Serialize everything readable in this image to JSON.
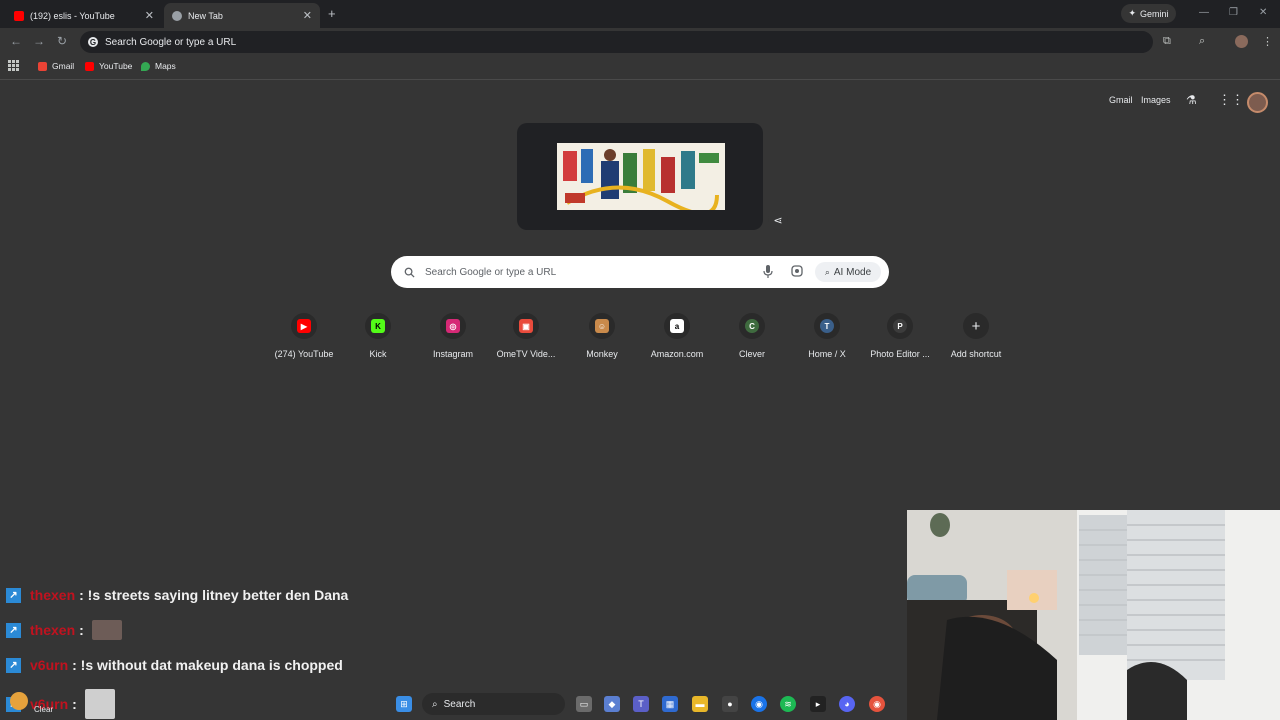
{
  "tabs": [
    {
      "title": "(192) eslis - YouTube",
      "favicon": "youtube-icon",
      "color": "#ff0000"
    },
    {
      "title": "New Tab",
      "favicon": "chrome-icon",
      "color": "#9aa0a6"
    }
  ],
  "gemini_label": "Gemini",
  "omnibox": {
    "placeholder": "Search Google or type a URL"
  },
  "bookmarks": [
    {
      "label": "Gmail",
      "icon": "gmail-icon",
      "color": "#ea4335"
    },
    {
      "label": "YouTube",
      "icon": "youtube-icon",
      "color": "#ff0000"
    },
    {
      "label": "Maps",
      "icon": "maps-icon",
      "color": "#34a853"
    }
  ],
  "top_links": {
    "gmail": "Gmail",
    "images": "Images"
  },
  "search": {
    "placeholder": "Search Google or type a URL",
    "ai_mode": "AI Mode"
  },
  "shortcuts": [
    {
      "label": "(274) YouTube",
      "icon": "youtube-icon",
      "color": "#ff0000",
      "letter": "▶"
    },
    {
      "label": "Kick",
      "icon": "kick-icon",
      "color": "#53fc18",
      "letter": "K"
    },
    {
      "label": "Instagram",
      "icon": "instagram-icon",
      "color": "#d62976",
      "letter": "◎"
    },
    {
      "label": "OmeTV Vide...",
      "icon": "ometv-icon",
      "color": "#e94b3c",
      "letter": "▣"
    },
    {
      "label": "Monkey",
      "icon": "monkey-icon",
      "color": "#c98a4b",
      "letter": "☺"
    },
    {
      "label": "Amazon.com",
      "icon": "amazon-icon",
      "color": "#ffffff",
      "letter": "a"
    },
    {
      "label": "Clever",
      "icon": "letter-c-icon",
      "color": "#3f6b3f",
      "letter": "C"
    },
    {
      "label": "Home / X",
      "icon": "letter-t-icon",
      "color": "#3a5f8a",
      "letter": "T"
    },
    {
      "label": "Photo Editor ...",
      "icon": "letter-p-icon",
      "color": "#3c3c3c",
      "letter": "P"
    },
    {
      "label": "Add shortcut",
      "icon": "plus-icon",
      "color": "#2a2a2a",
      "letter": "+"
    }
  ],
  "chat": [
    {
      "user": "thexen",
      "message": ": !s streets saying litney better den Dana",
      "has_image": false
    },
    {
      "user": "thexen",
      "message": ":",
      "has_image": true
    },
    {
      "user": "v6urn",
      "message": ": !s without dat makeup dana is chopped",
      "has_image": false
    },
    {
      "user": "v6urn",
      "message": ":",
      "has_image": true
    }
  ],
  "taskbar": {
    "search_label": "Search",
    "weather_label": "Clear"
  }
}
